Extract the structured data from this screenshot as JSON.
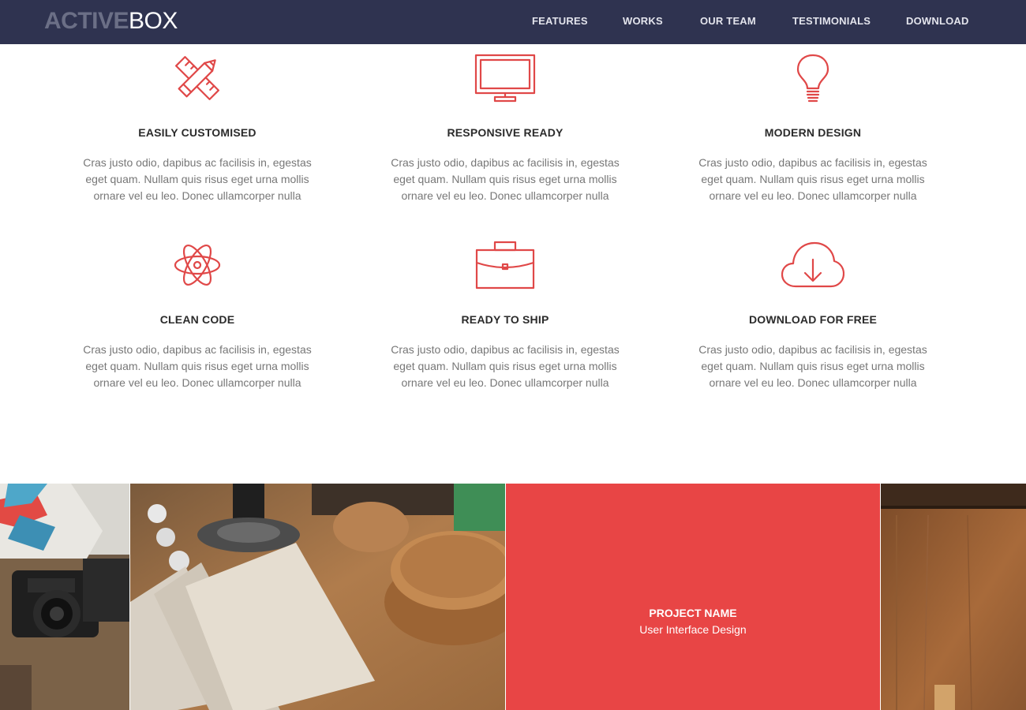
{
  "brand": {
    "bold": "ACTIVE",
    "light": "BOX"
  },
  "nav": {
    "items": [
      {
        "label": "FEATURES"
      },
      {
        "label": "WORKS"
      },
      {
        "label": "OUR TEAM"
      },
      {
        "label": "TESTIMONIALS"
      },
      {
        "label": "DOWNLOAD"
      }
    ]
  },
  "colors": {
    "header": "#2f3350",
    "accent": "#e04848",
    "overlay": "#e84545"
  },
  "features": [
    {
      "icon": "pencil-ruler-icon",
      "title": "EASILY CUSTOMISED",
      "text": "Cras justo odio, dapibus ac facilisis in, egestas eget quam. Nullam quis risus eget urna mollis ornare vel eu leo. Donec ullamcorper nulla"
    },
    {
      "icon": "monitor-icon",
      "title": "RESPONSIVE READY",
      "text": "Cras justo odio, dapibus ac facilisis in, egestas eget quam. Nullam quis risus eget urna mollis ornare vel eu leo. Donec ullamcorper nulla"
    },
    {
      "icon": "lightbulb-icon",
      "title": "MODERN DESIGN",
      "text": "Cras justo odio, dapibus ac facilisis in, egestas eget quam. Nullam quis risus eget urna mollis ornare vel eu leo. Donec ullamcorper nulla"
    },
    {
      "icon": "atom-icon",
      "title": "CLEAN CODE",
      "text": "Cras justo odio, dapibus ac facilisis in, egestas eget quam. Nullam quis risus eget urna mollis ornare vel eu leo. Donec ullamcorper nulla"
    },
    {
      "icon": "briefcase-icon",
      "title": "READY TO SHIP",
      "text": "Cras justo odio, dapibus ac facilisis in, egestas eget quam. Nullam quis risus eget urna mollis ornare vel eu leo. Donec ullamcorper nulla"
    },
    {
      "icon": "cloud-download-icon",
      "title": "DOWNLOAD FOR FREE",
      "text": "Cras justo odio, dapibus ac facilisis in, egestas eget quam. Nullam quis risus eget urna mollis ornare vel eu leo. Donec ullamcorper nulla"
    }
  ],
  "works": {
    "highlight": {
      "title": "PROJECT NAME",
      "subtitle": "User Interface Design"
    }
  }
}
